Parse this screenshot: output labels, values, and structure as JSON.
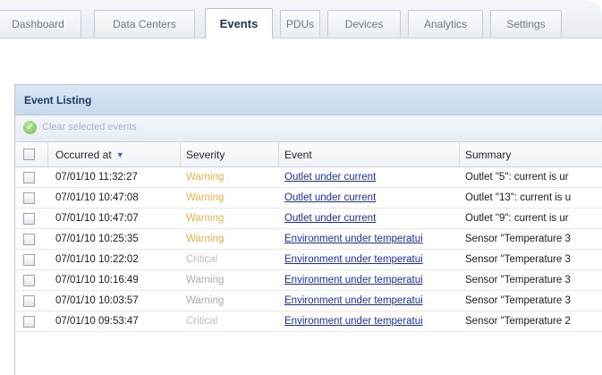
{
  "tabs": [
    {
      "label": "Dashboard",
      "active": false
    },
    {
      "label": "Data Centers",
      "active": false
    },
    {
      "label": "Events",
      "active": true
    },
    {
      "label": "PDUs",
      "active": false
    },
    {
      "label": "Devices",
      "active": false
    },
    {
      "label": "Analytics",
      "active": false
    },
    {
      "label": "Settings",
      "active": false
    }
  ],
  "panel": {
    "title": "Event Listing",
    "clear_label": "Clear selected events"
  },
  "grid": {
    "columns": [
      "Occurred at",
      "Severity",
      "Event",
      "Summary"
    ],
    "sort_icon": "sort-descending-icon",
    "rows": [
      {
        "occurred": "07/01/10 11:32:27",
        "severity": "Warning",
        "sev_class": "sev-warning",
        "event": "Outlet under current",
        "summary": "Outlet \"5\": current is ur"
      },
      {
        "occurred": "07/01/10 10:47:08",
        "severity": "Warning",
        "sev_class": "sev-warning",
        "event": "Outlet under current",
        "summary": "Outlet \"13\": current is u"
      },
      {
        "occurred": "07/01/10 10:47:07",
        "severity": "Warning",
        "sev_class": "sev-warning",
        "event": "Outlet under current",
        "summary": "Outlet \"9\": current is ur"
      },
      {
        "occurred": "07/01/10 10:25:35",
        "severity": "Warning",
        "sev_class": "sev-warning",
        "event": "Environment under temperatui",
        "summary": "Sensor \"Temperature 3"
      },
      {
        "occurred": "07/01/10 10:22:02",
        "severity": "Critical",
        "sev_class": "sev-critical",
        "event": "Environment under temperatui",
        "summary": "Sensor \"Temperature 3"
      },
      {
        "occurred": "07/01/10 10:16:49",
        "severity": "Warning",
        "sev_class": "sev-muted",
        "event": "Environment under temperatui",
        "summary": "Sensor \"Temperature 3"
      },
      {
        "occurred": "07/01/10 10:03:57",
        "severity": "Warning",
        "sev_class": "sev-muted",
        "event": "Environment under temperatui",
        "summary": "Sensor \"Temperature 3"
      },
      {
        "occurred": "07/01/10 09:53:47",
        "severity": "Critical",
        "sev_class": "sev-critical",
        "event": "Environment under temperatui",
        "summary": "Sensor \"Temperature 2"
      }
    ]
  },
  "colors": {
    "accent": "#1d3c63",
    "warning": "#e8b24a",
    "link": "#1a2fa8"
  }
}
